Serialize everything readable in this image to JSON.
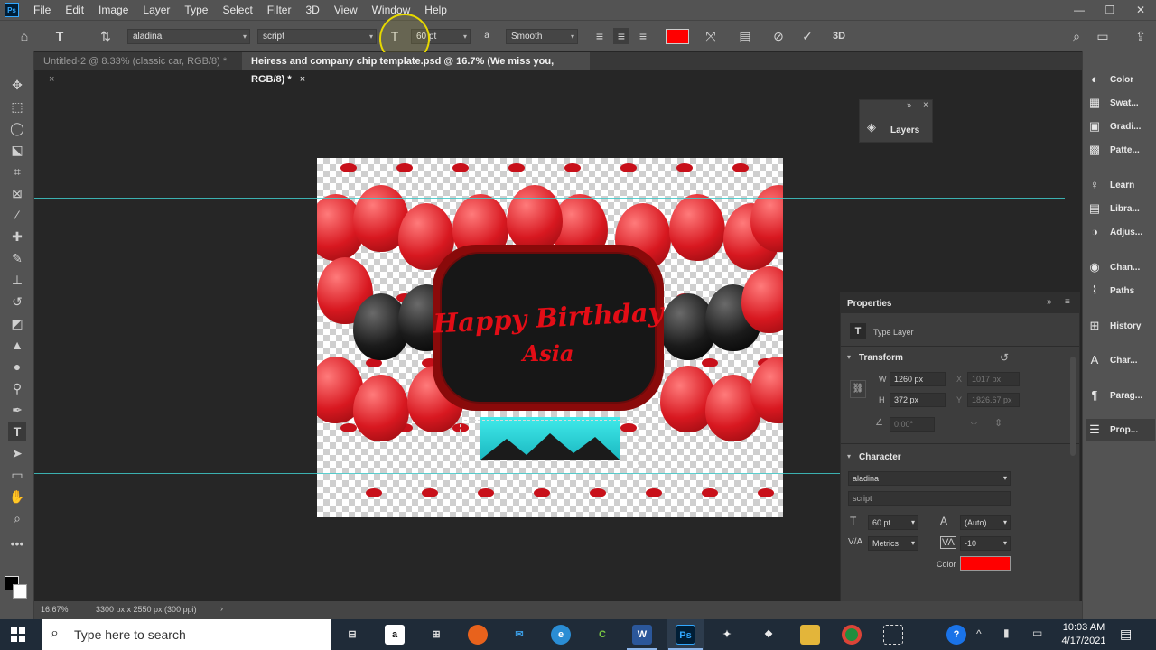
{
  "app": {
    "logo": "Ps"
  },
  "menu": [
    "File",
    "Edit",
    "Image",
    "Layer",
    "Type",
    "Select",
    "Filter",
    "3D",
    "View",
    "Window",
    "Help"
  ],
  "window_controls": {
    "minimize": "—",
    "restore": "❐",
    "close": "✕"
  },
  "options_bar": {
    "font_family": "aladina",
    "font_style": "script",
    "font_size": "60 pt",
    "aa_label": "a",
    "antialias": "Smooth",
    "text_color": "#ff0000",
    "threed": "3D"
  },
  "tabs": [
    {
      "label": "Untitled-2 @ 8.33% (classic car, RGB/8) *",
      "close": "×"
    },
    {
      "label": "Heiress and company chip template.psd @ 16.7% (We miss you, RGB/8) *",
      "close": "×"
    }
  ],
  "canvas_art": {
    "line1": "Happy Birthday",
    "line2": "Asia"
  },
  "layers_panel": {
    "title": "Layers",
    "collapse": "»",
    "close": "×"
  },
  "right_dock": [
    {
      "icon": "color-icon",
      "label": "Color"
    },
    {
      "icon": "swatches-icon",
      "label": "Swat..."
    },
    {
      "icon": "gradients-icon",
      "label": "Gradi..."
    },
    {
      "icon": "patterns-icon",
      "label": "Patte..."
    },
    {
      "icon": "learn-icon",
      "label": "Learn"
    },
    {
      "icon": "libraries-icon",
      "label": "Libra..."
    },
    {
      "icon": "adjustments-icon",
      "label": "Adjus..."
    },
    {
      "icon": "channels-icon",
      "label": "Chan..."
    },
    {
      "icon": "paths-icon",
      "label": "Paths"
    },
    {
      "icon": "history-icon",
      "label": "History"
    },
    {
      "icon": "character-icon",
      "label": "Char..."
    },
    {
      "icon": "paragraph-icon",
      "label": "Parag..."
    },
    {
      "icon": "properties-icon",
      "label": "Prop..."
    }
  ],
  "properties": {
    "title": "Properties",
    "layer_type": "Type Layer",
    "transform_title": "Transform",
    "w_label": "W",
    "w": "1260 px",
    "h_label": "H",
    "h": "372 px",
    "x_label": "X",
    "x": "1017 px",
    "y_label": "Y",
    "y": "1826.67 px",
    "angle": "0.00°",
    "character_title": "Character",
    "font_family": "aladina",
    "font_style": "script",
    "size": "60 pt",
    "leading": "(Auto)",
    "kerning": "Metrics",
    "tracking": "-10",
    "color_label": "Color",
    "color": "#ff0000"
  },
  "status": {
    "zoom": "16.67%",
    "info": "3300 px x 2550 px (300 ppi)",
    "arrow": "›"
  },
  "taskbar": {
    "search_placeholder": "Type here to search",
    "time": "10:03 AM",
    "date": "4/17/2021",
    "word": "W",
    "ps": "Ps"
  }
}
